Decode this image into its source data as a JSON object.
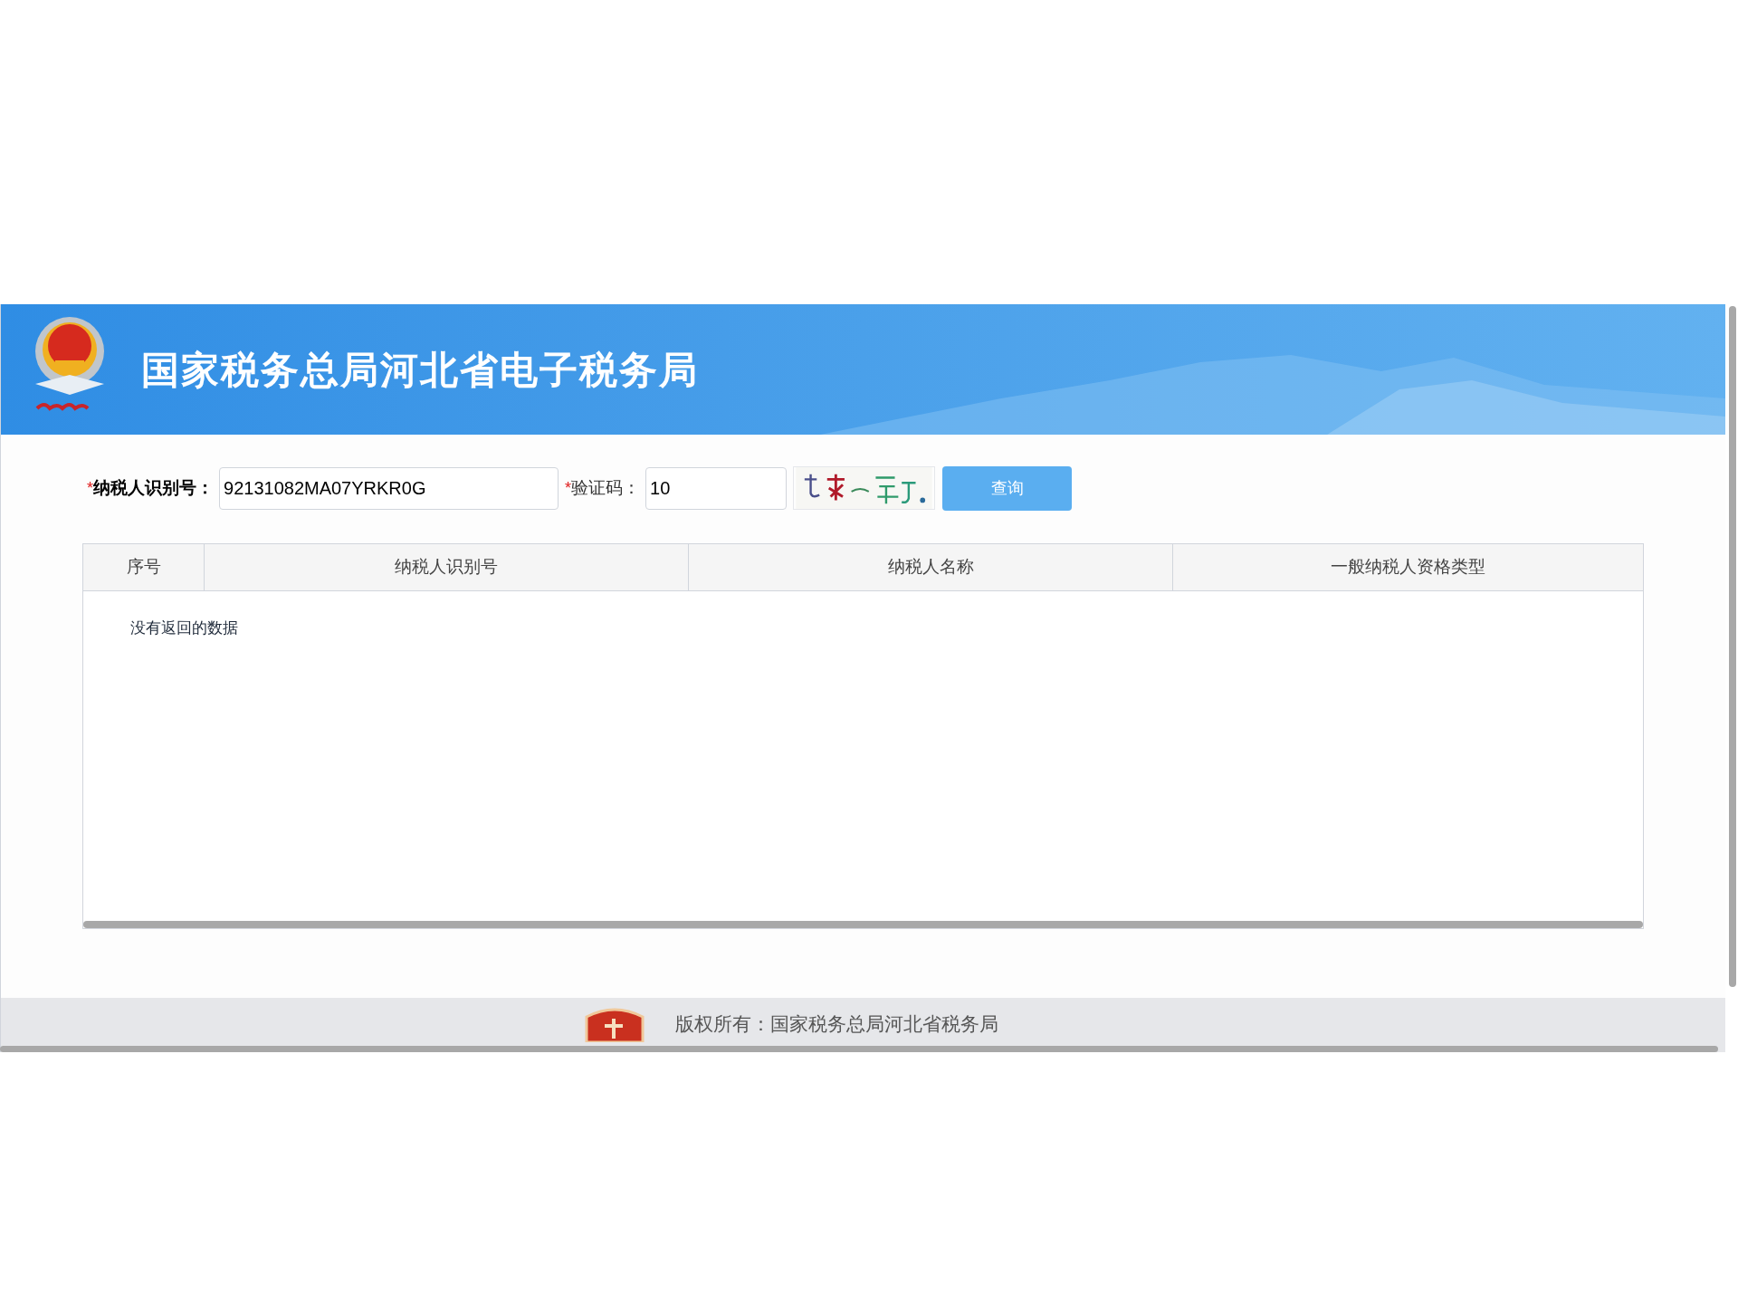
{
  "header": {
    "title": "国家税务总局河北省电子税务局"
  },
  "form": {
    "fields": [
      {
        "label": "纳税人识别号：",
        "required_mark": "*",
        "value": "92131082MA07YRKR0G",
        "kind": "text"
      },
      {
        "label": "验证码：",
        "required_mark": "*",
        "value": "10",
        "kind": "captcha"
      }
    ],
    "button": "查询"
  },
  "table": {
    "columns": [
      "序号",
      "纳税人识别号",
      "纳税人名称",
      "一般纳税人资格类型"
    ],
    "empty_message": "没有返回的数据"
  },
  "footer": {
    "text": "版权所有：国家税务总局河北省税务局"
  }
}
